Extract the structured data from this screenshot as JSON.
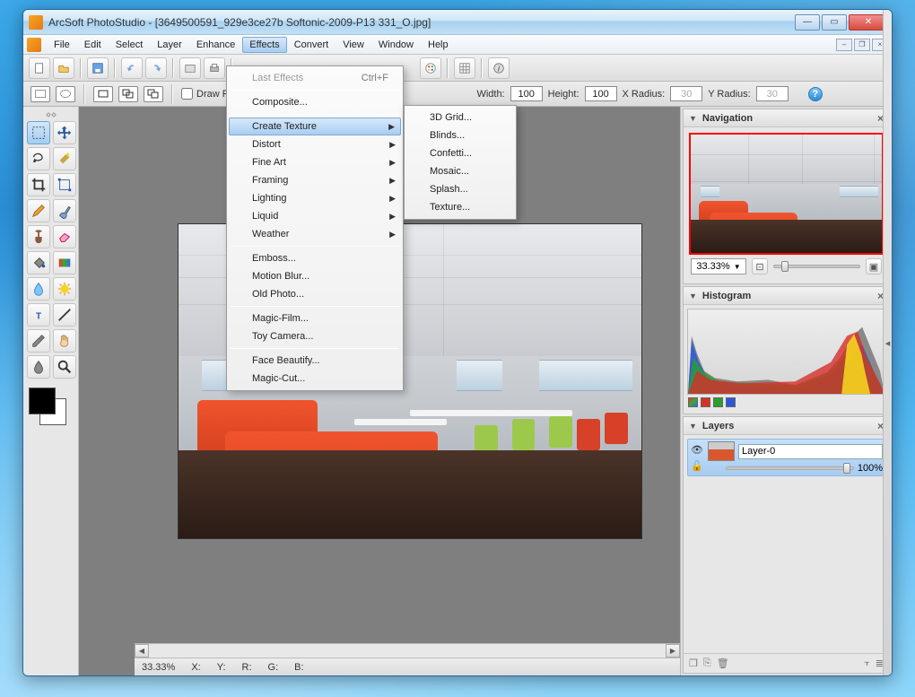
{
  "title": "ArcSoft PhotoStudio - [3649500591_929e3ce27b Softonic-2009-P13 331_O.jpg]",
  "menubar": [
    "File",
    "Edit",
    "Select",
    "Layer",
    "Enhance",
    "Effects",
    "Convert",
    "View",
    "Window",
    "Help"
  ],
  "active_menu_index": 5,
  "optionbar": {
    "draw_from_center": "Draw From Center",
    "width_label": "Width:",
    "width_value": "100",
    "height_label": "Height:",
    "height_value": "100",
    "xr_label": "X Radius:",
    "xr_value": "30",
    "yr_label": "Y Radius:",
    "yr_value": "30"
  },
  "effects_menu": {
    "last": "Last Effects",
    "last_shortcut": "Ctrl+F",
    "composite": "Composite...",
    "create_texture": "Create Texture",
    "distort": "Distort",
    "fine_art": "Fine Art",
    "framing": "Framing",
    "lighting": "Lighting",
    "liquid": "Liquid",
    "weather": "Weather",
    "emboss": "Emboss...",
    "motion_blur": "Motion Blur...",
    "old_photo": "Old Photo...",
    "magic_film": "Magic-Film...",
    "toy_camera": "Toy Camera...",
    "face_beautify": "Face Beautify...",
    "magic_cut": "Magic-Cut..."
  },
  "texture_submenu": [
    "3D Grid...",
    "Blinds...",
    "Confetti...",
    "Mosaic...",
    "Splash...",
    "Texture..."
  ],
  "panels": {
    "navigation": "Navigation",
    "histogram": "Histogram",
    "layers": "Layers"
  },
  "zoom_pct": "33.33%",
  "layer": {
    "name": "Layer-0",
    "opacity": "100%"
  },
  "status": {
    "zoom": "33.33%",
    "x": "X:",
    "y": "Y:",
    "r": "R:",
    "g": "G:",
    "b": "B:"
  },
  "tool_names": [
    "marquee-rect",
    "move",
    "lasso",
    "magic-wand",
    "crop",
    "transform",
    "pencil",
    "brush",
    "clone-stamp",
    "eraser",
    "paint-bucket",
    "gradient",
    "blur",
    "dodge",
    "text",
    "line",
    "eyedropper",
    "hand",
    "smudge",
    "zoom"
  ]
}
